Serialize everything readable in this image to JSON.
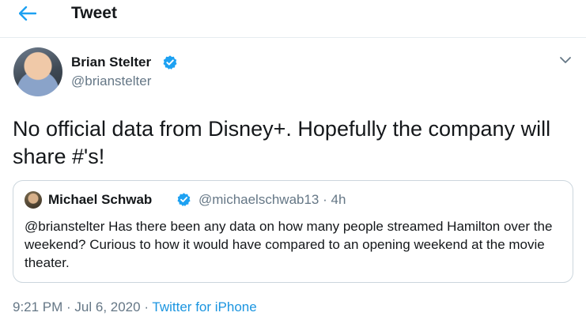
{
  "header": {
    "title": "Tweet",
    "back_icon": "arrow-left-icon"
  },
  "tweet": {
    "author": {
      "name": "Brian Stelter",
      "handle": "@brianstelter",
      "verified": true
    },
    "text": "No official data from Disney+. Hopefully the company will share #'s!",
    "quoted": {
      "name": "Michael Schwab",
      "handle": "@michaelschwab13",
      "separator": "·",
      "time": "4h",
      "text": "@brianstelter Has there been any data on how many people streamed Hamilton over the weekend? Curious to how it would have compared to an opening weekend at the movie theater."
    },
    "timestamp": "9:21 PM · Jul 6, 2020 ·",
    "source": "Twitter for iPhone"
  },
  "colors": {
    "accent": "#1da1f2",
    "link": "#1b95e0",
    "muted": "#657786",
    "border": "#ccd6dd"
  }
}
